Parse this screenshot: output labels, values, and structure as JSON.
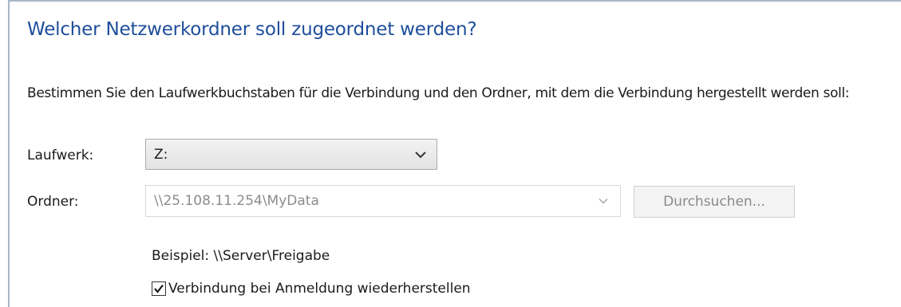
{
  "wizard": {
    "heading": "Welcher Netzwerkordner soll zugeordnet werden?",
    "description": "Bestimmen Sie den Laufwerkbuchstaben für die Verbindung und den Ordner, mit dem die Verbindung hergestellt werden soll:"
  },
  "drive": {
    "label": "Laufwerk:",
    "selected": "Z:",
    "icon": "chevron-down-icon"
  },
  "folder": {
    "label": "Ordner:",
    "value": "\\\\25.108.11.254\\MyData",
    "icon": "chevron-down-icon",
    "browse_label": "Durchsuchen...",
    "example": "Beispiel: \\\\Server\\Freigabe"
  },
  "reconnect": {
    "label": "Verbindung bei Anmeldung wiederherstellen",
    "checked": true,
    "icon": "checkmark-icon"
  },
  "colors": {
    "heading": "#1e4e9b",
    "frame": "#a9b7c8",
    "disabled_text": "#8c8c8c"
  }
}
